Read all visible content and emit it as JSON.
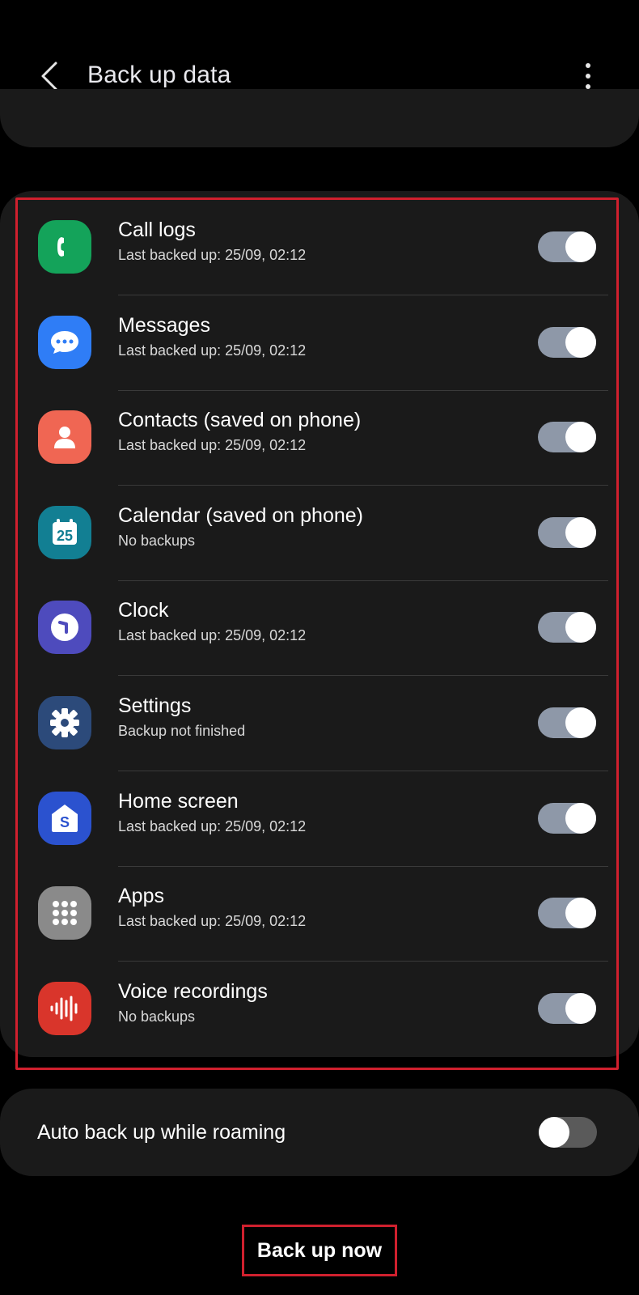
{
  "app_bar": {
    "title": "Back up data",
    "back_icon": "chevron-left-icon",
    "more_icon": "more-vert-icon"
  },
  "items": [
    {
      "title": "Call logs",
      "subtitle": "Last backed up: 25/09, 02:12",
      "icon": "phone-icon",
      "icon_color": "#14a35a",
      "enabled": true
    },
    {
      "title": "Messages",
      "subtitle": "Last backed up: 25/09, 02:12",
      "icon": "message-icon",
      "icon_color": "#2f7df6",
      "enabled": true
    },
    {
      "title": "Contacts (saved on phone)",
      "subtitle": "Last backed up: 25/09, 02:12",
      "icon": "person-icon",
      "icon_color": "#f06653",
      "enabled": true
    },
    {
      "title": "Calendar (saved on phone)",
      "subtitle": "No backups",
      "icon": "calendar-icon",
      "icon_color": "#127f93",
      "icon_text": "25",
      "enabled": true
    },
    {
      "title": "Clock",
      "subtitle": "Last backed up: 25/09, 02:12",
      "icon": "clock-icon",
      "icon_color": "#4e4bbd",
      "enabled": true
    },
    {
      "title": "Settings",
      "subtitle": "Backup not finished",
      "icon": "gear-icon",
      "icon_color": "#2c4a7a",
      "enabled": true
    },
    {
      "title": "Home screen",
      "subtitle": "Last backed up: 25/09, 02:12",
      "icon": "home-screen-icon",
      "icon_color": "#2b52cf",
      "icon_text": "S",
      "enabled": true
    },
    {
      "title": "Apps",
      "subtitle": "Last backed up: 25/09, 02:12",
      "icon": "apps-grid-icon",
      "icon_color": "#8a8a8a",
      "enabled": true
    },
    {
      "title": "Voice recordings",
      "subtitle": "No backups",
      "icon": "voice-wave-icon",
      "icon_color": "#d9352b",
      "enabled": true
    }
  ],
  "roaming": {
    "label": "Auto back up while roaming",
    "enabled": false
  },
  "backup_button": {
    "label": "Back up now"
  },
  "colors": {
    "background": "#000000",
    "card": "#1a1a1a",
    "toggle_on": "#8e98a8",
    "highlight": "#d0202e"
  }
}
